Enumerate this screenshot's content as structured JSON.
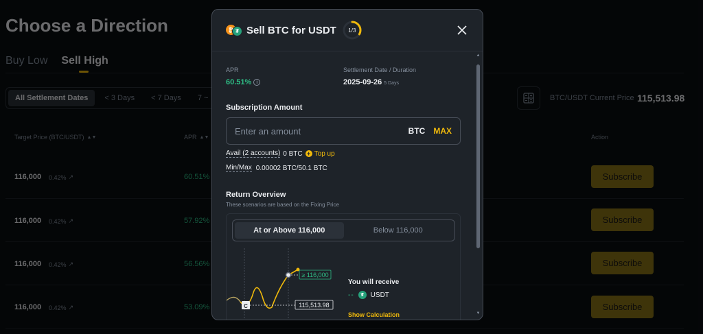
{
  "page": {
    "title": "Choose a Direction",
    "tabs": [
      {
        "label": "Buy Low"
      },
      {
        "label": "Sell High"
      }
    ],
    "filters": [
      {
        "label": "All Settlement Dates"
      },
      {
        "label": "< 3 Days"
      },
      {
        "label": "< 7 Days"
      },
      {
        "label": "7 ~"
      }
    ],
    "current_price_label": "BTC/USDT Current Price",
    "current_price_value": "115,513.98",
    "columns": {
      "target": "Target Price (BTC/USDT)",
      "apr": "APR",
      "action": "Action"
    },
    "rows": [
      {
        "price": "116,000",
        "pct": "0.42%",
        "apr": "60.51%",
        "action": "Subscribe"
      },
      {
        "price": "116,000",
        "pct": "0.42%",
        "apr": "57.92%",
        "action": "Subscribe"
      },
      {
        "price": "116,000",
        "pct": "0.42%",
        "apr": "56.56%",
        "action": "Subscribe"
      },
      {
        "price": "116,000",
        "pct": "0.42%",
        "apr": "53.09%",
        "action": "Subscribe"
      }
    ]
  },
  "modal": {
    "title": "Sell BTC for USDT",
    "step": "1/3",
    "step_progress": 0.33,
    "apr_label": "APR",
    "apr_value": "60.51%",
    "settlement_label": "Settlement Date / Duration",
    "settlement_date": "2025-09-26",
    "duration": "5 Days",
    "subscription_title": "Subscription Amount",
    "amount_placeholder": "Enter an amount",
    "amount_unit": "BTC",
    "max_label": "MAX",
    "avail_label": "Avail (2 accounts)",
    "avail_value": "0 BTC",
    "topup_label": "Top up",
    "minmax_label": "Min/Max",
    "minmax_value": "0.00002 BTC/50.1 BTC",
    "return_title": "Return Overview",
    "return_subtitle": "These scenarios are based on the Fixing Price",
    "scenario_tabs": [
      {
        "label": "At or Above 116,000"
      },
      {
        "label": "Below 116,000"
      }
    ],
    "chart_target_label": "≥ 116,000",
    "chart_current_label": "115,513.98",
    "chart_c_marker": "C",
    "receive_title": "You will receive",
    "receive_currency": "USDT",
    "show_calc": "Show Calculation"
  },
  "colors": {
    "accent": "#f0b90b",
    "positive": "#2ebd85",
    "subscribe_bg": "#8a7417",
    "background": "#0b0e11",
    "modal_bg": "#1e2329"
  }
}
